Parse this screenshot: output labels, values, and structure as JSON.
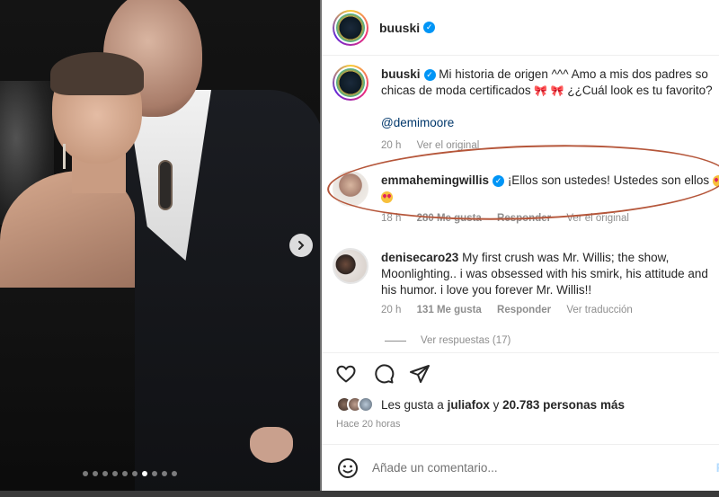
{
  "post": {
    "username": "buuski",
    "caption_text": "Mi historia de origen ^^^ Amo a mis dos padres so",
    "caption_line2": "chicas de moda certificados",
    "caption_line2_tail": "¿¿Cuál look es tu favorito?",
    "caption_mention": "@demimoore",
    "caption_time": "20 h",
    "caption_translate": "Ver el original"
  },
  "comments": [
    {
      "username": "emmahemingwillis",
      "text": "¡Ellos son ustedes! Ustedes son ellos",
      "time": "18 h",
      "likes": "280 Me gusta",
      "reply": "Responder",
      "translate": "Ver el original"
    },
    {
      "username": "denisecaro23",
      "text_line1": "My first crush was Mr. Willis; the show,",
      "text_line2": "Moonlighting.. i was obsessed with his smirk, his attitude and",
      "text_line3": "his humor. i love you forever Mr. Willis!!",
      "time": "20 h",
      "likes": "131 Me gusta",
      "reply": "Responder",
      "translate": "Ver traducción",
      "view_replies": "Ver respuestas (17)"
    }
  ],
  "likes": {
    "prefix": "Les gusta a",
    "user": "juliafox",
    "joiner": "y",
    "others": "20.783 personas más"
  },
  "timestamp": "Hace 20 horas",
  "add_comment": {
    "placeholder": "Añade un comentario...",
    "post_label": "Pu"
  },
  "carousel": {
    "dot_count": 10,
    "active_index": 6
  },
  "colors": {
    "verified": "#0095f6",
    "highlight_ellipse": "#b5563a",
    "mention": "#00376b"
  },
  "icons": [
    "heart-icon",
    "comment-icon",
    "share-icon",
    "emoji-icon",
    "chevron-right-icon",
    "verified-badge-icon"
  ]
}
